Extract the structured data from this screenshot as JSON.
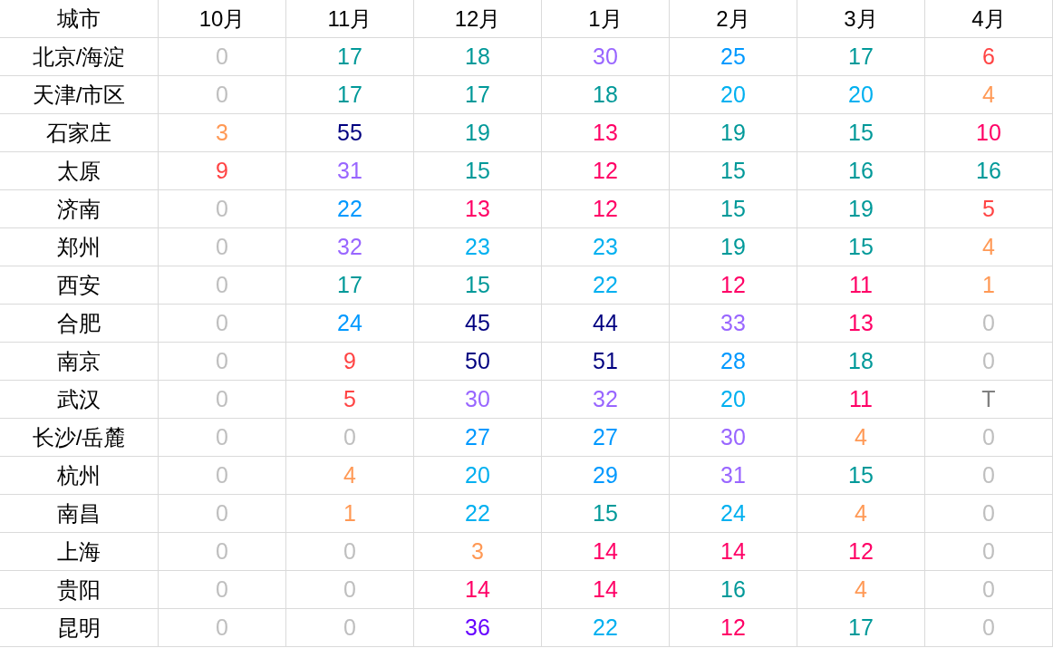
{
  "table": {
    "columns": [
      "城市",
      "10月",
      "11月",
      "12月",
      "1月",
      "2月",
      "3月",
      "4月"
    ],
    "rows": [
      {
        "cells": [
          {
            "text": "北京/海淀"
          },
          {
            "text": "0",
            "color": "#bfbfbf"
          },
          {
            "text": "17",
            "color": "#009999"
          },
          {
            "text": "18",
            "color": "#009999"
          },
          {
            "text": "30",
            "color": "#9966ff"
          },
          {
            "text": "25",
            "color": "#0099ff"
          },
          {
            "text": "17",
            "color": "#009999"
          },
          {
            "text": "6",
            "color": "#ff4444"
          }
        ]
      },
      {
        "cells": [
          {
            "text": "天津/市区"
          },
          {
            "text": "0",
            "color": "#bfbfbf"
          },
          {
            "text": "17",
            "color": "#009999"
          },
          {
            "text": "17",
            "color": "#009999"
          },
          {
            "text": "18",
            "color": "#009999"
          },
          {
            "text": "20",
            "color": "#00b0f0"
          },
          {
            "text": "20",
            "color": "#00b0f0"
          },
          {
            "text": "4",
            "color": "#ff9955"
          }
        ]
      },
      {
        "cells": [
          {
            "text": "石家庄"
          },
          {
            "text": "3",
            "color": "#ff9955"
          },
          {
            "text": "55",
            "color": "#000080"
          },
          {
            "text": "19",
            "color": "#009999"
          },
          {
            "text": "13",
            "color": "#ff0066"
          },
          {
            "text": "19",
            "color": "#009999"
          },
          {
            "text": "15",
            "color": "#009999"
          },
          {
            "text": "10",
            "color": "#ff0066"
          }
        ]
      },
      {
        "cells": [
          {
            "text": "太原"
          },
          {
            "text": "9",
            "color": "#ff4444"
          },
          {
            "text": "31",
            "color": "#9966ff"
          },
          {
            "text": "15",
            "color": "#009999"
          },
          {
            "text": "12",
            "color": "#ff0066"
          },
          {
            "text": "15",
            "color": "#009999"
          },
          {
            "text": "16",
            "color": "#009999"
          },
          {
            "text": "16",
            "color": "#009999"
          }
        ]
      },
      {
        "cells": [
          {
            "text": "济南"
          },
          {
            "text": "0",
            "color": "#bfbfbf"
          },
          {
            "text": "22",
            "color": "#0099ff"
          },
          {
            "text": "13",
            "color": "#ff0066"
          },
          {
            "text": "12",
            "color": "#ff0066"
          },
          {
            "text": "15",
            "color": "#009999"
          },
          {
            "text": "19",
            "color": "#009999"
          },
          {
            "text": "5",
            "color": "#ff4444"
          }
        ]
      },
      {
        "cells": [
          {
            "text": "郑州"
          },
          {
            "text": "0",
            "color": "#bfbfbf"
          },
          {
            "text": "32",
            "color": "#9966ff"
          },
          {
            "text": "23",
            "color": "#00b0f0"
          },
          {
            "text": "23",
            "color": "#00b0f0"
          },
          {
            "text": "19",
            "color": "#009999"
          },
          {
            "text": "15",
            "color": "#009999"
          },
          {
            "text": "4",
            "color": "#ff9955"
          }
        ]
      },
      {
        "cells": [
          {
            "text": "西安"
          },
          {
            "text": "0",
            "color": "#bfbfbf"
          },
          {
            "text": "17",
            "color": "#009999"
          },
          {
            "text": "15",
            "color": "#009999"
          },
          {
            "text": "22",
            "color": "#00b0f0"
          },
          {
            "text": "12",
            "color": "#ff0066"
          },
          {
            "text": "11",
            "color": "#ff0066"
          },
          {
            "text": "1",
            "color": "#ff9955"
          }
        ]
      },
      {
        "cells": [
          {
            "text": "合肥"
          },
          {
            "text": "0",
            "color": "#bfbfbf"
          },
          {
            "text": "24",
            "color": "#0099ff"
          },
          {
            "text": "45",
            "color": "#000080"
          },
          {
            "text": "44",
            "color": "#000080"
          },
          {
            "text": "33",
            "color": "#9966ff"
          },
          {
            "text": "13",
            "color": "#ff0066"
          },
          {
            "text": "0",
            "color": "#bfbfbf"
          }
        ]
      },
      {
        "cells": [
          {
            "text": "南京"
          },
          {
            "text": "0",
            "color": "#bfbfbf"
          },
          {
            "text": "9",
            "color": "#ff4444"
          },
          {
            "text": "50",
            "color": "#000080"
          },
          {
            "text": "51",
            "color": "#000080"
          },
          {
            "text": "28",
            "color": "#0099ff"
          },
          {
            "text": "18",
            "color": "#009999"
          },
          {
            "text": "0",
            "color": "#bfbfbf"
          }
        ]
      },
      {
        "cells": [
          {
            "text": "武汉"
          },
          {
            "text": "0",
            "color": "#bfbfbf"
          },
          {
            "text": "5",
            "color": "#ff4444"
          },
          {
            "text": "30",
            "color": "#9966ff"
          },
          {
            "text": "32",
            "color": "#9966ff"
          },
          {
            "text": "20",
            "color": "#00b0f0"
          },
          {
            "text": "11",
            "color": "#ff0066"
          },
          {
            "text": "T",
            "color": "#808080"
          }
        ]
      },
      {
        "cells": [
          {
            "text": "长沙/岳麓"
          },
          {
            "text": "0",
            "color": "#bfbfbf"
          },
          {
            "text": "0",
            "color": "#bfbfbf"
          },
          {
            "text": "27",
            "color": "#0099ff"
          },
          {
            "text": "27",
            "color": "#0099ff"
          },
          {
            "text": "30",
            "color": "#9966ff"
          },
          {
            "text": "4",
            "color": "#ff9955"
          },
          {
            "text": "0",
            "color": "#bfbfbf"
          }
        ]
      },
      {
        "cells": [
          {
            "text": "杭州"
          },
          {
            "text": "0",
            "color": "#bfbfbf"
          },
          {
            "text": "4",
            "color": "#ff9955"
          },
          {
            "text": "20",
            "color": "#00b0f0"
          },
          {
            "text": "29",
            "color": "#0099ff"
          },
          {
            "text": "31",
            "color": "#9966ff"
          },
          {
            "text": "15",
            "color": "#009999"
          },
          {
            "text": "0",
            "color": "#bfbfbf"
          }
        ]
      },
      {
        "cells": [
          {
            "text": "南昌"
          },
          {
            "text": "0",
            "color": "#bfbfbf"
          },
          {
            "text": "1",
            "color": "#ff9955"
          },
          {
            "text": "22",
            "color": "#00b0f0"
          },
          {
            "text": "15",
            "color": "#009999"
          },
          {
            "text": "24",
            "color": "#00b0f0"
          },
          {
            "text": "4",
            "color": "#ff9955"
          },
          {
            "text": "0",
            "color": "#bfbfbf"
          }
        ]
      },
      {
        "cells": [
          {
            "text": "上海"
          },
          {
            "text": "0",
            "color": "#bfbfbf"
          },
          {
            "text": "0",
            "color": "#bfbfbf"
          },
          {
            "text": "3",
            "color": "#ff9955"
          },
          {
            "text": "14",
            "color": "#ff0066"
          },
          {
            "text": "14",
            "color": "#ff0066"
          },
          {
            "text": "12",
            "color": "#ff0066"
          },
          {
            "text": "0",
            "color": "#bfbfbf"
          }
        ]
      },
      {
        "cells": [
          {
            "text": "贵阳"
          },
          {
            "text": "0",
            "color": "#bfbfbf"
          },
          {
            "text": "0",
            "color": "#bfbfbf"
          },
          {
            "text": "14",
            "color": "#ff0066"
          },
          {
            "text": "14",
            "color": "#ff0066"
          },
          {
            "text": "16",
            "color": "#009999"
          },
          {
            "text": "4",
            "color": "#ff9955"
          },
          {
            "text": "0",
            "color": "#bfbfbf"
          }
        ]
      },
      {
        "cells": [
          {
            "text": "昆明"
          },
          {
            "text": "0",
            "color": "#bfbfbf"
          },
          {
            "text": "0",
            "color": "#bfbfbf"
          },
          {
            "text": "36",
            "color": "#6600ff"
          },
          {
            "text": "22",
            "color": "#00b0f0"
          },
          {
            "text": "12",
            "color": "#ff0066"
          },
          {
            "text": "17",
            "color": "#009999"
          },
          {
            "text": "0",
            "color": "#bfbfbf"
          }
        ]
      }
    ]
  }
}
